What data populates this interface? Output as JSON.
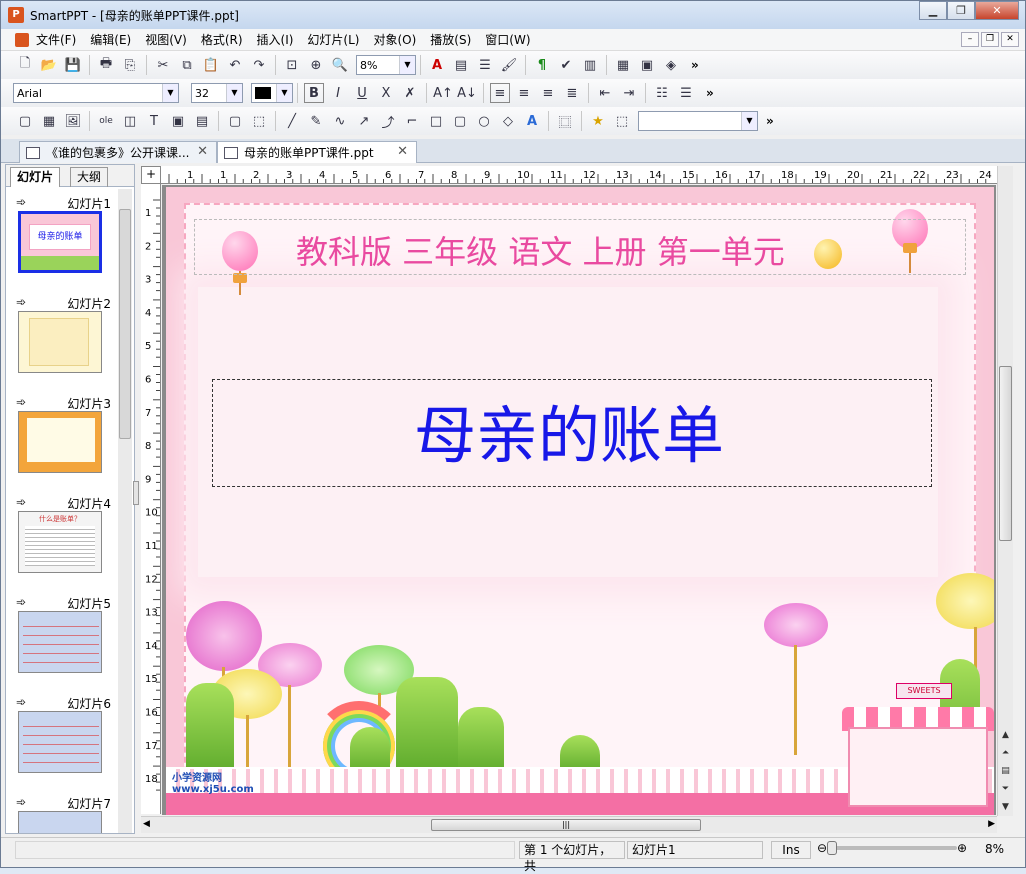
{
  "window": {
    "title": "SmartPPT - [母亲的账单PPT课件.ppt]",
    "app_icon": "P"
  },
  "menu": [
    "文件(F)",
    "编辑(E)",
    "视图(V)",
    "格式(R)",
    "插入(I)",
    "幻灯片(L)",
    "对象(O)",
    "播放(S)",
    "窗口(W)"
  ],
  "toolbar1": {
    "zoom_value": "8%"
  },
  "toolbar2": {
    "font_name": "Arial",
    "font_size": "32"
  },
  "doc_tabs": [
    {
      "label": "《谁的包裹多》公开课课..."
    },
    {
      "label": "母亲的账单PPT课件.ppt"
    }
  ],
  "panel_tabs": {
    "slides": "幻灯片",
    "outline": "大纲"
  },
  "slides": [
    {
      "label": "幻灯片1",
      "thumb_text": "母亲的账单"
    },
    {
      "label": "幻灯片2"
    },
    {
      "label": "幻灯片3"
    },
    {
      "label": "幻灯片4",
      "thumb_text": "什么是账单？"
    },
    {
      "label": "幻灯片5"
    },
    {
      "label": "幻灯片6"
    },
    {
      "label": "幻灯片7"
    }
  ],
  "ruler": {
    "top": [
      "1",
      "1",
      "2",
      "3",
      "4",
      "5",
      "6",
      "7",
      "8",
      "9",
      "10",
      "11",
      "12",
      "13",
      "14",
      "15",
      "16",
      "17",
      "18",
      "19",
      "20",
      "21",
      "22",
      "23",
      "24"
    ],
    "left": [
      "1",
      "2",
      "3",
      "4",
      "5",
      "6",
      "7",
      "8",
      "9",
      "10",
      "11",
      "12",
      "13",
      "14",
      "15",
      "16",
      "17",
      "18"
    ]
  },
  "slide": {
    "subtitle": "教科版 三年级 语文 上册 第一单元",
    "title": "母亲的账单",
    "logo_text": "小学资源网",
    "logo_url": "www.xj5u.com",
    "shop_sign": "SWEETS"
  },
  "status": {
    "slide_pos": "第 1 个幻灯片，共",
    "slide_name": "幻灯片1",
    "mode": "Ins",
    "zoom": "8%"
  },
  "colors": {
    "title": "#1818e8",
    "subtitle": "#e94aa0",
    "slide_bg": "#f9c7d7"
  }
}
